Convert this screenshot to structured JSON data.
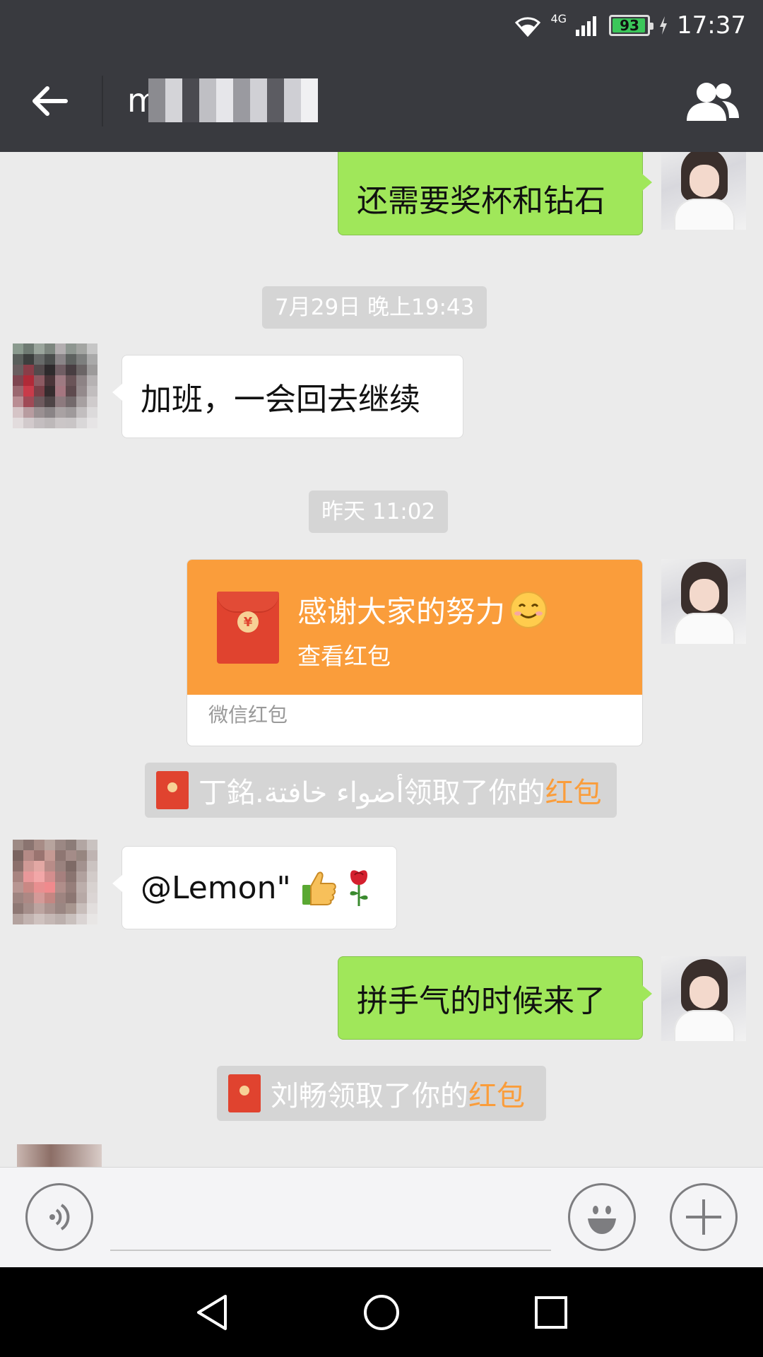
{
  "status_bar": {
    "network": "4G",
    "battery": "93",
    "time": "17:37"
  },
  "header": {
    "title": "m"
  },
  "messages": {
    "m1": "还需要奖杯和钻石",
    "t1": "7月29日 晚上19:43",
    "m2": "加班，一会回去继续",
    "t2": "昨天 11:02",
    "hongbao": {
      "title": "感谢大家的努力",
      "action": "查看红包",
      "footer": "微信红包"
    },
    "n1": {
      "prefix": "丁銘.أضواء خافتة领取了你的",
      "link": "红包"
    },
    "m3": "@Lemon\"",
    "m4": "拼手气的时候来了",
    "n2": {
      "prefix": "刘畅领取了你的",
      "link": "红包"
    }
  },
  "colors": {
    "topbar": "#393a3f",
    "my_bubble": "#a0e75a",
    "hongbao": "#fa9d3b",
    "chat_bg": "#ebebeb"
  },
  "icons": [
    "back-arrow-icon",
    "group-members-icon",
    "voice-icon",
    "emoji-icon",
    "plus-icon",
    "nav-back-icon",
    "nav-home-icon",
    "nav-recent-icon"
  ]
}
